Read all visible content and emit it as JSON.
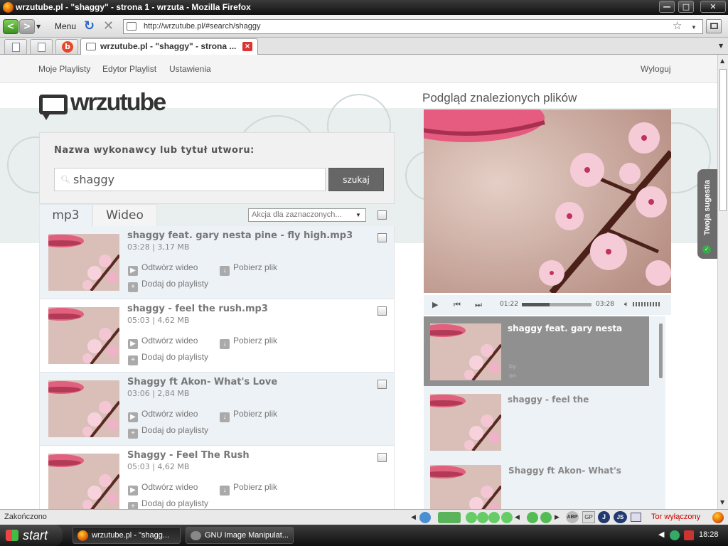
{
  "window": {
    "title": "wrzutube.pl - \"shaggy\" - strona 1 - wrzuta - Mozilla Firefox",
    "minimize": "—",
    "maximize": "□",
    "close": "✕"
  },
  "toolbar": {
    "back": "<",
    "forward": ">",
    "menu_label": "Menu",
    "reload": "↻",
    "stop": "✕",
    "url": "http://wrzutube.pl/#search/shaggy",
    "bookmark_star": "☆"
  },
  "tabs": {
    "active_title": "wrzutube.pl - \"shaggy\" - strona ...",
    "close": "✕"
  },
  "site_nav": {
    "items": [
      "Moje Playlisty",
      "Edytor Playlist",
      "Ustawienia"
    ],
    "logout": "Wyloguj"
  },
  "logo": {
    "text": "wrzutube"
  },
  "search": {
    "label": "Nazwa wykonawcy lub tytuł utworu:",
    "query": "shaggy",
    "button": "szukaj"
  },
  "result_tabs": [
    "mp3",
    "Wideo"
  ],
  "bulk_action": {
    "placeholder": "Akcja dla zaznaczonych..."
  },
  "actions": {
    "play_video": "Odtwórz wideo",
    "download": "Pobierz plik",
    "add_playlist": "Dodaj do playlisty"
  },
  "results": [
    {
      "title": "shaggy feat. gary nesta pine - fly high.mp3",
      "meta": "03:28 | 3,17 MB"
    },
    {
      "title": "shaggy - feel the rush.mp3",
      "meta": "05:03 | 4,62 MB"
    },
    {
      "title": "Shaggy ft Akon- What's Love",
      "meta": "03:06 | 2,84 MB"
    },
    {
      "title": "Shaggy - Feel The Rush",
      "meta": "05:03 | 4,62 MB"
    }
  ],
  "preview": {
    "heading": "Podgląd znalezionych plików",
    "time_current": "01:22",
    "time_total": "03:28",
    "progress": 0.4
  },
  "playlist": [
    {
      "title": "shaggy feat. gary nesta",
      "by": "by",
      "on": "on"
    },
    {
      "title": "shaggy - feel the"
    },
    {
      "title": "Shaggy ft Akon- What's"
    }
  ],
  "suggestion": {
    "label": "Twoja sugestia"
  },
  "statusbar": {
    "status": "Zakończono",
    "abp": "ABP",
    "gp": "GP",
    "j": "J",
    "js": "JS",
    "tor": "Tor wyłączony"
  },
  "taskbar": {
    "start": "start",
    "tasks": [
      "wrzutube.pl - \"shagg...",
      "GNU Image Manipulat..."
    ],
    "clock": "18:28"
  },
  "colors": {
    "accent_dark": "#666666",
    "row_alt": "#edf2f6",
    "tor_red": "#cc0000",
    "suggest_green": "#3aa84a"
  }
}
